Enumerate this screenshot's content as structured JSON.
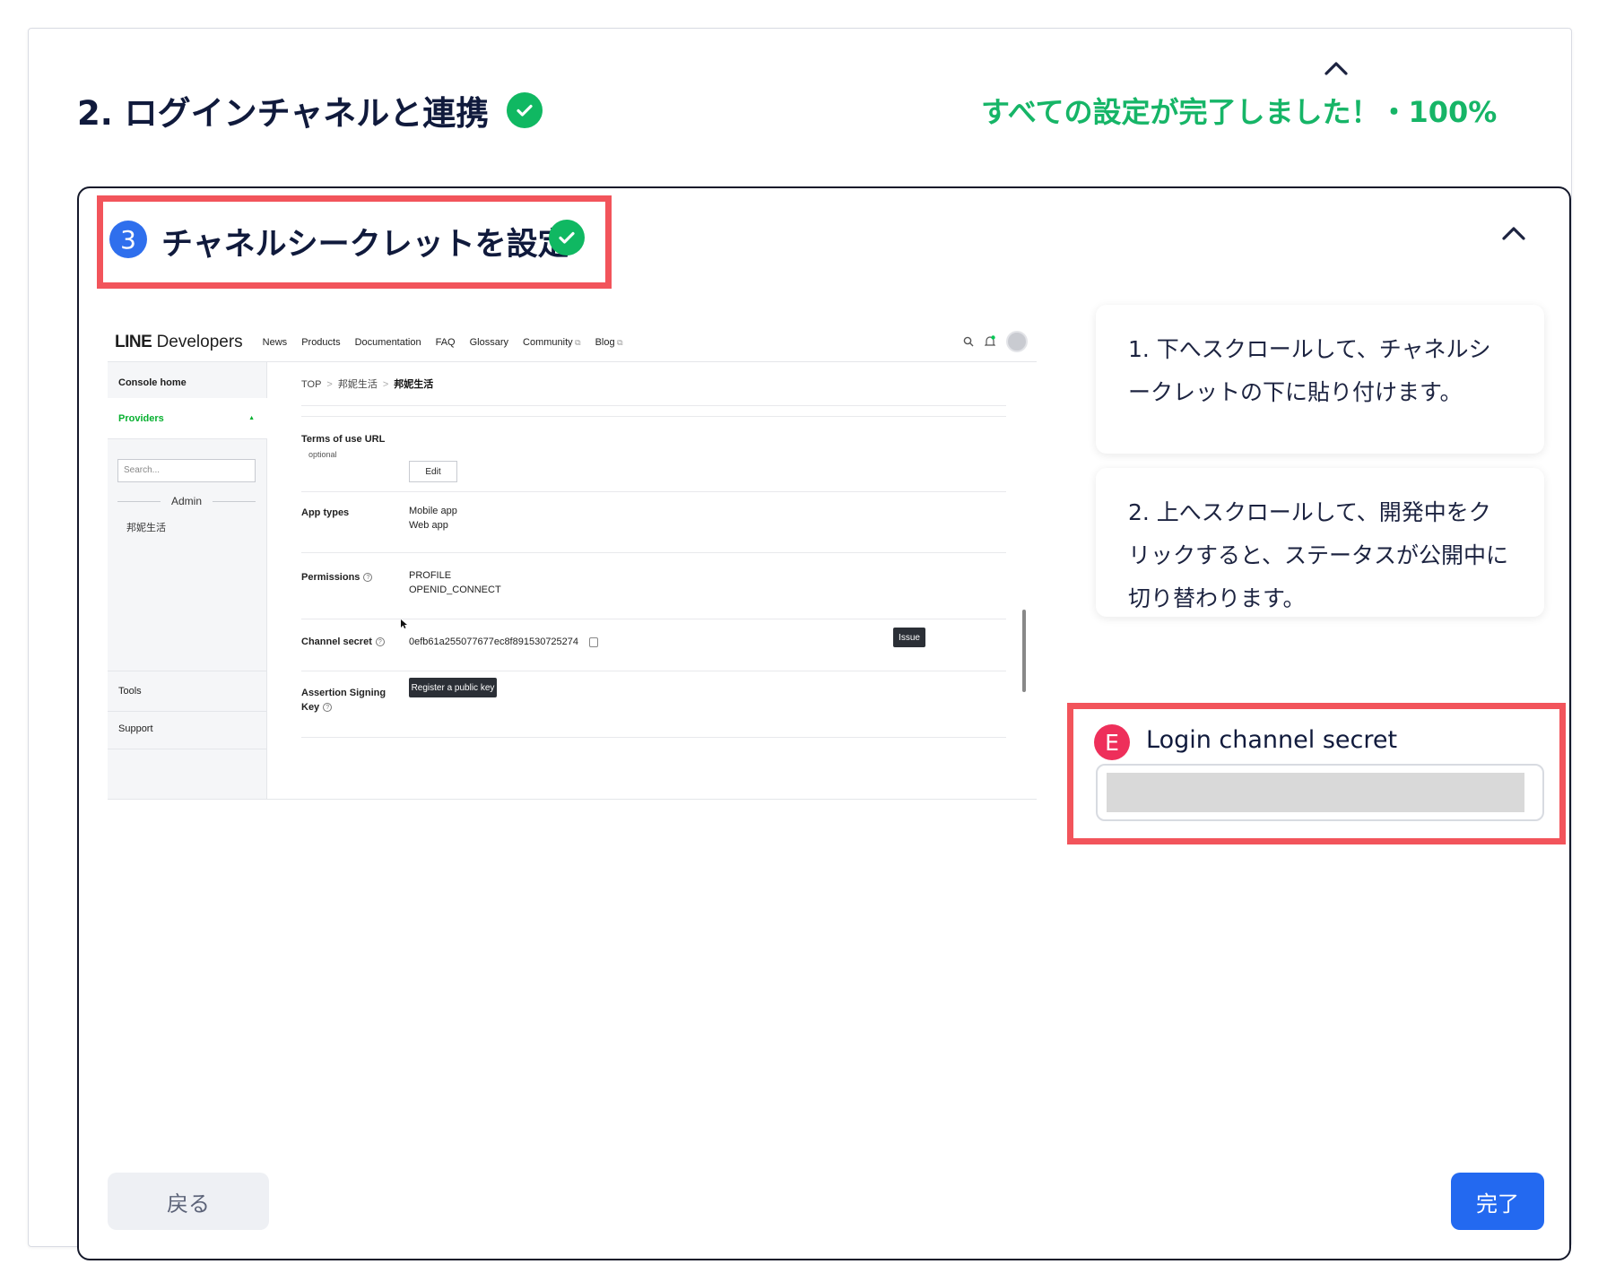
{
  "section": {
    "title": "2. ログインチャネルと連携",
    "status": "すべての設定が完了しました！・100%",
    "progress_percent": 100
  },
  "step": {
    "number": "3",
    "title": "チャネルシークレットを設定"
  },
  "screenshot": {
    "brand_strong": "LINE",
    "brand_rest": "Developers",
    "nav": [
      "News",
      "Products",
      "Documentation",
      "FAQ",
      "Glossary",
      "Community",
      "Blog"
    ],
    "sidebar": {
      "console_home": "Console home",
      "providers": "Providers",
      "search_placeholder": "Search...",
      "admin": "Admin",
      "org": "邦妮生活",
      "tools": "Tools",
      "support": "Support"
    },
    "breadcrumb": [
      "TOP",
      "邦妮生活",
      "邦妮生活"
    ],
    "terms_label": "Terms of use URL",
    "terms_sub": "optional",
    "edit_label": "Edit",
    "app_types_label": "App types",
    "app_types": [
      "Mobile app",
      "Web app"
    ],
    "permissions_label": "Permissions",
    "permissions": [
      "PROFILE",
      "OPENID_CONNECT"
    ],
    "secret_label": "Channel secret",
    "secret_value": "0efb61a255077677ec8f891530725274",
    "issue_label": "Issue",
    "assertion_label_1": "Assertion Signing",
    "assertion_label_2": "Key",
    "register_label": "Register a public key"
  },
  "instructions": [
    "1. 下へスクロールして、チャネルシークレットの下に貼り付けます。",
    "2. 上へスクロールして、開発中をクリックすると、ステータスが公開中に切り替わります。"
  ],
  "field": {
    "badge": "E",
    "label": "Login channel secret",
    "value": ""
  },
  "buttons": {
    "back": "戻る",
    "done": "完了"
  },
  "colors": {
    "accent": "#2369f0",
    "success": "#10b862",
    "highlight": "#f2545b",
    "badge": "#ee2f5a"
  }
}
